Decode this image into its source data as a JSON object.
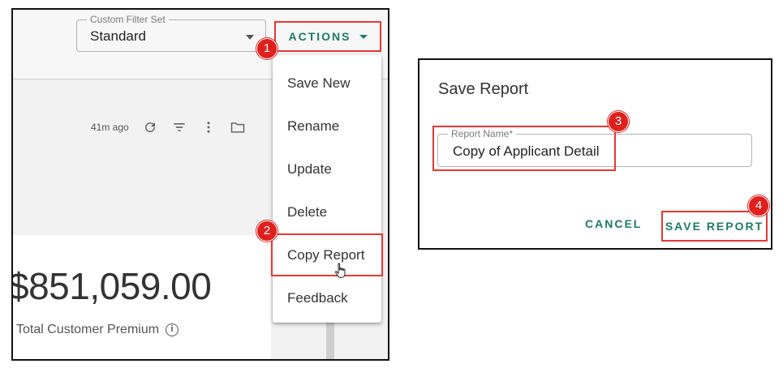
{
  "filter": {
    "label": "Custom Filter Set",
    "value": "Standard"
  },
  "actions_button": {
    "label": "ACTIONS"
  },
  "toolbar": {
    "time_text": "41m ago"
  },
  "menu": {
    "items": [
      {
        "label": "Save New"
      },
      {
        "label": "Rename"
      },
      {
        "label": "Update"
      },
      {
        "label": "Delete"
      },
      {
        "label": "Copy Report"
      },
      {
        "label": "Feedback"
      }
    ]
  },
  "metric": {
    "value": "$851,059.00",
    "label": "Total Customer Premium",
    "info_icon": "i"
  },
  "dialog": {
    "title": "Save Report",
    "field_label": "Report Name*",
    "field_value": "Copy of Applicant Detail",
    "cancel_label": "CANCEL",
    "save_label": "SAVE REPORT"
  },
  "badges": [
    "1",
    "2",
    "3",
    "4"
  ],
  "colors": {
    "accent_green": "#1f7a64",
    "highlight_red": "#e53935",
    "badge_red": "#e0201c"
  }
}
